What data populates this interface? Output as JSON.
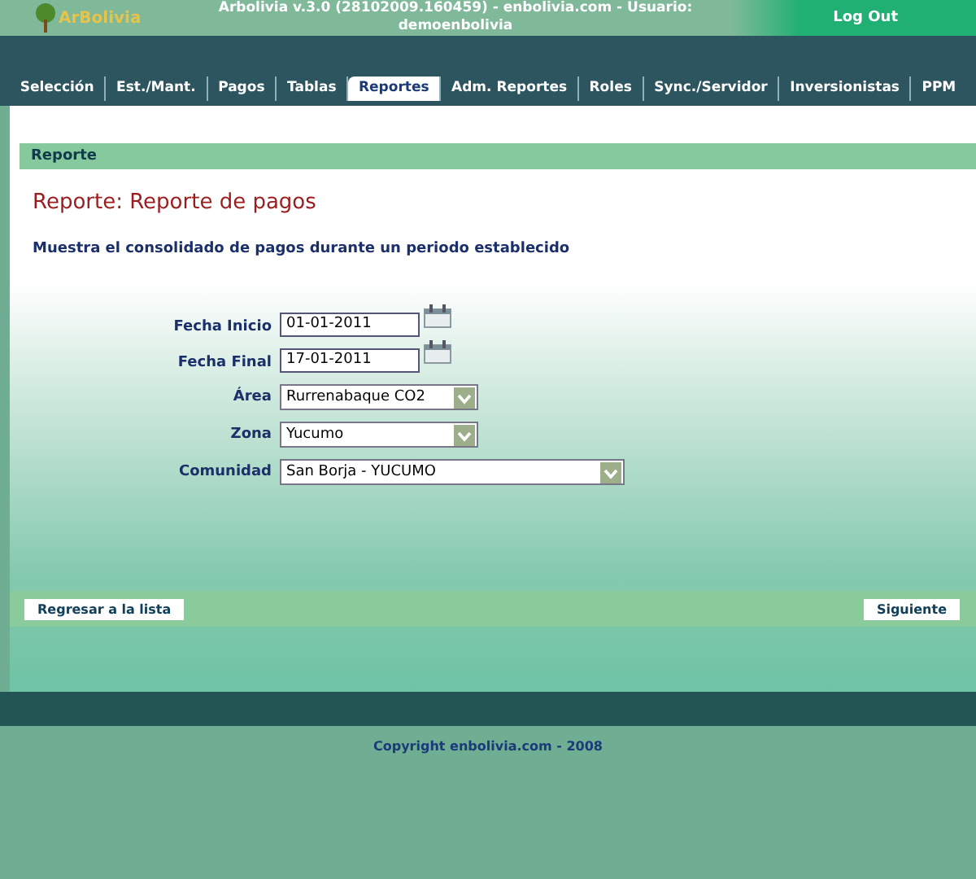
{
  "header": {
    "logo": "ArBolivia",
    "title": "Arbolivia v.3.0 (28102009.160459) - enbolivia.com  - Usuario: demoenbolivia",
    "logout": "Log Out"
  },
  "tabs": [
    {
      "label": "Selección",
      "selected": false
    },
    {
      "label": "Est./Mant.",
      "selected": false
    },
    {
      "label": "Pagos",
      "selected": false
    },
    {
      "label": "Tablas",
      "selected": false
    },
    {
      "label": "Reportes",
      "selected": true
    },
    {
      "label": "Adm. Reportes",
      "selected": false
    },
    {
      "label": "Roles",
      "selected": false
    },
    {
      "label": "Sync./Servidor",
      "selected": false
    },
    {
      "label": "Inversionistas",
      "selected": false
    },
    {
      "label": "PPM",
      "selected": false
    }
  ],
  "section": "Reporte",
  "heading": "Reporte: Reporte de pagos",
  "description": "Muestra el consolidado de pagos durante un periodo establecido",
  "fields": [
    {
      "kind": "date",
      "label": "Fecha Inicio",
      "value": "01-01-2011"
    },
    {
      "kind": "date",
      "label": "Fecha Final",
      "value": "17-01-2011"
    },
    {
      "kind": "select",
      "label": "Área",
      "value": "Rurrenabaque CO2"
    },
    {
      "kind": "select",
      "label": "Zona",
      "value": "Yucumo"
    },
    {
      "kind": "wide-select",
      "label": "Comunidad",
      "value": "San Borja - YUCUMO"
    }
  ],
  "buttons": {
    "back": "Regresar a la lista",
    "next": "Siguiente"
  },
  "footer": "Copyright enbolivia.com - 2008"
}
